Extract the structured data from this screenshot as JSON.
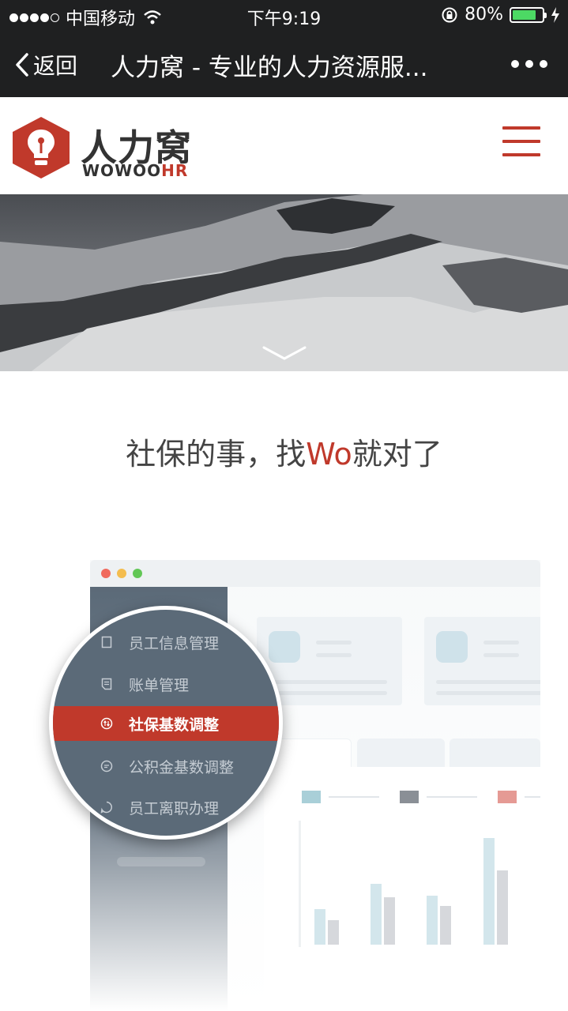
{
  "status_bar": {
    "carrier": "中国移动",
    "time": "下午9:19",
    "battery_percent": "80%",
    "battery_level": 0.8,
    "signal_bars_filled": 4,
    "signal_bars_total": 5
  },
  "nav": {
    "back_label": "返回",
    "title": "人力窝 - 专业的人力资源服..."
  },
  "logo": {
    "name_cn": "人力窝",
    "name_en_prefix": "WOWOO",
    "name_en_suffix": "HR"
  },
  "slogan": {
    "prefix": "社保的事，找",
    "highlight": "Wo",
    "suffix": "就对了"
  },
  "menu": {
    "items": [
      {
        "label": "员工信息管理",
        "icon": "document-icon",
        "active": false
      },
      {
        "label": "账单管理",
        "icon": "bill-icon",
        "active": false
      },
      {
        "label": "社保基数调整",
        "icon": "adjust-icon",
        "active": true
      },
      {
        "label": "公积金基数调整",
        "icon": "chat-icon",
        "active": false
      },
      {
        "label": "员工离职办理",
        "icon": "leave-icon",
        "active": false
      }
    ]
  },
  "colors": {
    "brand_red": "#c0392b",
    "dark_bar": "#1f2021",
    "sidebar_slate": "#5b6a78",
    "battery_green": "#4cd964"
  }
}
